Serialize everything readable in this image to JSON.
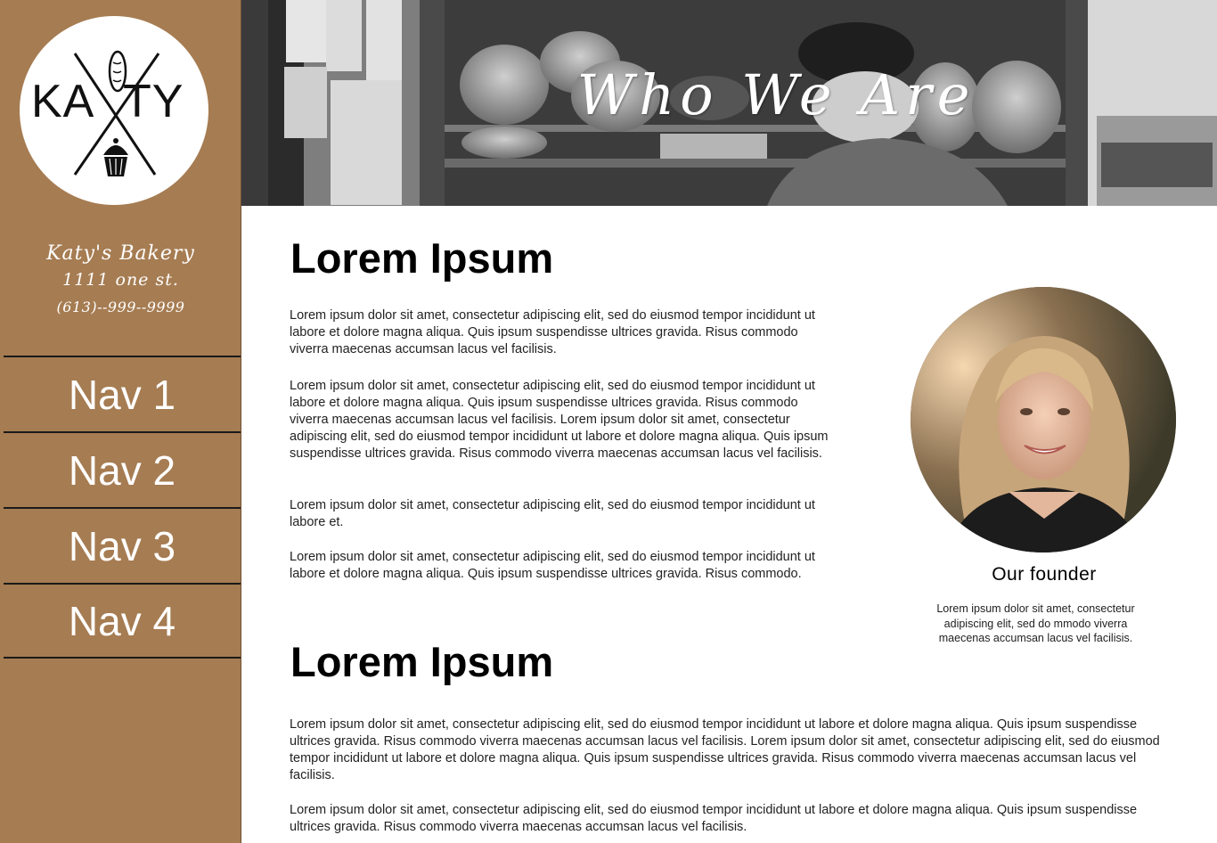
{
  "sidebar": {
    "logo": {
      "left": "KA",
      "right": "TY"
    },
    "bakery_name": "Katy's Bakery",
    "address": "1111 one st.",
    "phone": "(613)--999--9999",
    "nav": [
      {
        "label": "Nav 1"
      },
      {
        "label": "Nav 2"
      },
      {
        "label": "Nav 3"
      },
      {
        "label": "Nav 4"
      }
    ],
    "color": "#a67c52"
  },
  "hero": {
    "title": "Who We Are"
  },
  "main": {
    "heading_1": "Lorem Ipsum",
    "heading_2": "Lorem Ipsum",
    "paragraphs": [
      "Lorem ipsum dolor sit amet, consectetur adipiscing elit, sed do eiusmod tempor incididunt ut labore et dolore magna aliqua. Quis ipsum suspendisse ultrices gravida. Risus commodo viverra maecenas accumsan lacus vel facilisis.",
      "Lorem ipsum dolor sit amet, consectetur adipiscing elit, sed do eiusmod tempor incididunt ut labore et dolore magna aliqua. Quis ipsum suspendisse ultrices gravida. Risus commodo viverra maecenas accumsan lacus vel facilisis. Lorem ipsum dolor sit amet, consectetur adipiscing elit, sed do eiusmod tempor incididunt ut labore et dolore magna aliqua. Quis ipsum suspendisse ultrices gravida. Risus commodo viverra maecenas accumsan lacus vel facilisis.",
      "Lorem ipsum dolor sit amet, consectetur adipiscing elit, sed do eiusmod tempor incididunt ut labore et.",
      "Lorem ipsum dolor sit amet, consectetur adipiscing elit, sed do eiusmod tempor incididunt ut labore et dolore magna aliqua. Quis ipsum suspendisse ultrices gravida. Risus commodo.",
      "Lorem ipsum dolor sit amet, consectetur adipiscing elit, sed do eiusmod tempor incididunt ut labore et dolore magna aliqua. Quis ipsum suspendisse ultrices gravida. Risus commodo viverra maecenas accumsan lacus vel facilisis. Lorem ipsum dolor sit amet, consectetur adipiscing elit, sed do eiusmod tempor incididunt ut labore et dolore magna aliqua. Quis ipsum suspendisse ultrices gravida. Risus commodo viverra maecenas accumsan lacus vel facilisis.",
      "Lorem ipsum dolor sit amet, consectetur adipiscing elit, sed do eiusmod tempor incididunt ut labore et dolore magna aliqua. Quis ipsum suspendisse ultrices gravida. Risus commodo viverra maecenas accumsan lacus vel facilisis."
    ]
  },
  "founder": {
    "caption": "Our founder",
    "description": "Lorem ipsum dolor sit amet, consectetur adipiscing elit, sed do mmodo viverra maecenas accumsan lacus vel facilisis."
  }
}
